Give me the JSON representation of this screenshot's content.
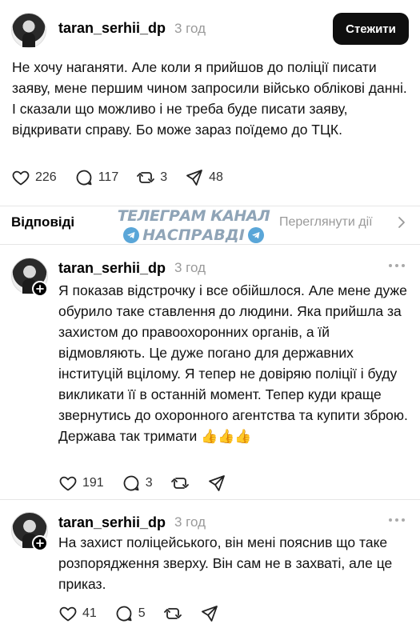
{
  "post": {
    "username": "taran_serhii_dp",
    "time": "3 год",
    "follow_label": "Стежити",
    "text": "Не хочу наганяти. Але коли я прийшов до поліції писати заяву, мене першим чином запросили військо облікові данні. І сказали що можливо і не треба буде писати заяву, відкривати справу. Бо може зараз поїдемо до ТЦК.",
    "likes": "226",
    "comments": "117",
    "reposts": "3",
    "shares": "48"
  },
  "replies_bar": {
    "title": "Відповіді",
    "view_activity": "Переглянути дії"
  },
  "watermark": {
    "line1": "ТЕЛЕГРАМ КАНАЛ",
    "line2": "НАСПРАВДІ"
  },
  "replies": [
    {
      "username": "taran_serhii_dp",
      "time": "3 год",
      "text": "Я показав відстрочку і все обійшлося. Але мене дуже обурило таке ставлення до людини. Яка прийшла за захистом до правоохоронних органів, а їй відмовляють. Це дуже погано для державних інституцій вцілому. Я тепер не довіряю поліції і буду викликати її в останній момент. Тепер куди краще звернутись до охоронного агентства та купити зброю. Держава так тримати",
      "emoji": "👍👍👍",
      "likes": "191",
      "comments": "3"
    },
    {
      "username": "taran_serhii_dp",
      "time": "3 год",
      "text": "На захист поліцейського, він мені пояснив що таке розпорядження зверху. Він сам не в захваті, але це приказ.",
      "likes": "41",
      "comments": "5"
    }
  ],
  "icons": {
    "like": "heart-icon",
    "comment": "comment-bubble-icon",
    "repost": "repost-icon",
    "share": "send-icon",
    "more": "more-icon",
    "chevron": "chevron-right-icon"
  },
  "colors": {
    "follow_bg": "#0f0f0f",
    "muted": "#9a9a9a",
    "watermark": "#8fa4b7",
    "telegram": "#5aa6d8"
  }
}
